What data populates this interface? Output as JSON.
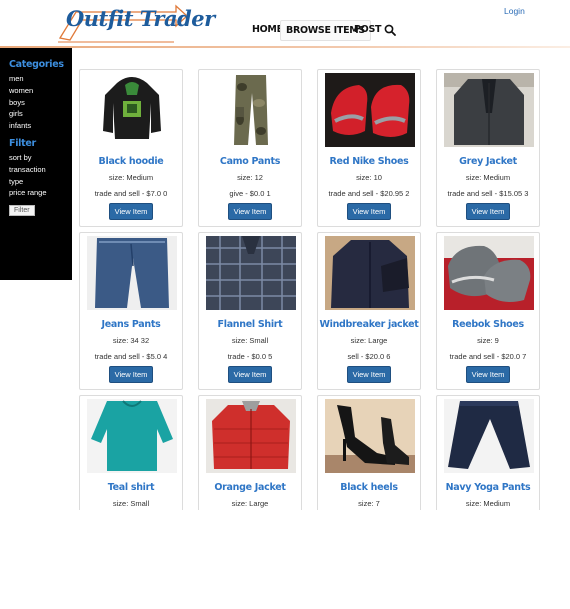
{
  "header": {
    "logo_text": "Outfit Trader",
    "nav": {
      "home": "HOME",
      "browse": "BROWSE ITEMS",
      "post": "POST"
    },
    "login": "Login",
    "accent_color": "#1e5c9c"
  },
  "sidebar": {
    "categories_title": "Categories",
    "categories": [
      "men",
      "women",
      "boys",
      "girls",
      "infants"
    ],
    "filter_title": "Filter",
    "filters": [
      "sort by",
      "transaction",
      "type",
      "price range"
    ],
    "filter_button": "Filter"
  },
  "items": [
    {
      "title": "Black hoodie",
      "size": "size: Medium",
      "price": "trade and sell - $7.0 0",
      "button": "View Item"
    },
    {
      "title": "Camo Pants",
      "size": "size: 12",
      "price": "give - $0.0 1",
      "button": "View Item"
    },
    {
      "title": "Red Nike Shoes",
      "size": "size: 10",
      "price": "trade and sell - $20.95 2",
      "button": "View Item"
    },
    {
      "title": "Grey Jacket",
      "size": "size: Medium",
      "price": "trade and sell - $15.05 3",
      "button": "View Item"
    },
    {
      "title": "Jeans Pants",
      "size": "size: 34 32",
      "price": "trade and sell - $5.0 4",
      "button": "View Item"
    },
    {
      "title": "Flannel Shirt",
      "size": "size: Small",
      "price": "trade - $0.0 5",
      "button": "View Item"
    },
    {
      "title": "Windbreaker jacket",
      "size": "size: Large",
      "price": "sell - $20.0 6",
      "button": "View Item"
    },
    {
      "title": "Reebok Shoes",
      "size": "size: 9",
      "price": "trade and sell - $20.0 7",
      "button": "View Item"
    },
    {
      "title": "Teal shirt",
      "size": "size: Small",
      "price": "",
      "button": ""
    },
    {
      "title": "Orange Jacket",
      "size": "size: Large",
      "price": "",
      "button": ""
    },
    {
      "title": "Black heels",
      "size": "size: 7",
      "price": "",
      "button": ""
    },
    {
      "title": "Navy Yoga Pants",
      "size": "size: Medium",
      "price": "",
      "button": ""
    }
  ]
}
